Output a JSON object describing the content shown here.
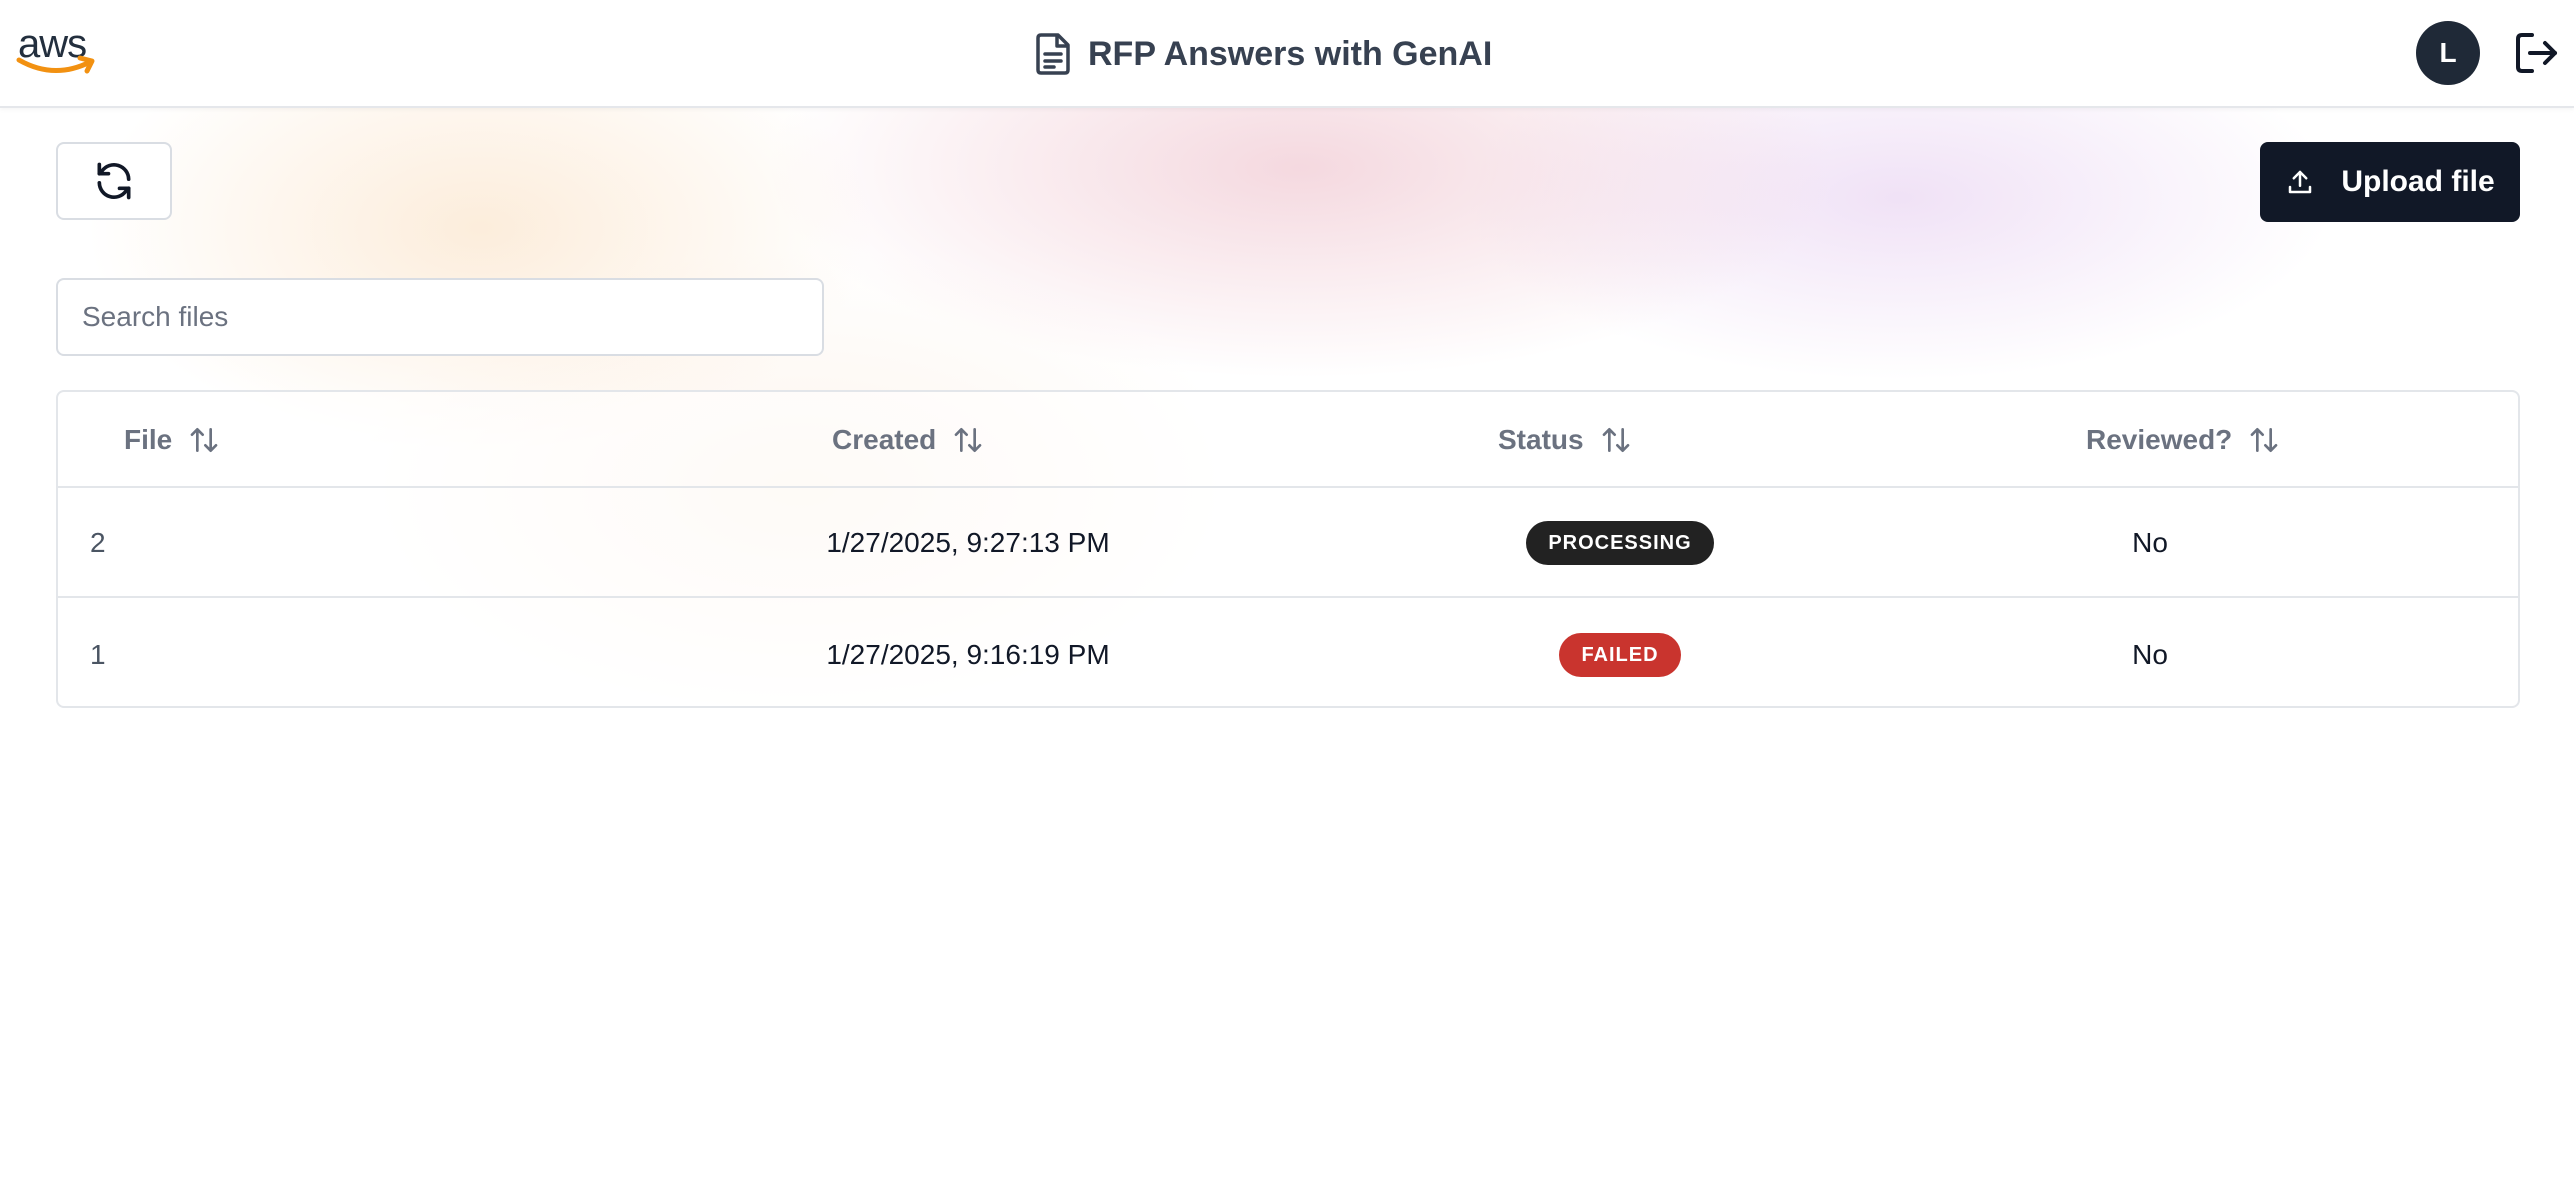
{
  "app": {
    "logo_text": "aws",
    "title": "RFP Answers with GenAI",
    "user_initial": "L"
  },
  "toolbar": {
    "refresh_icon": "refresh-icon",
    "upload_label": "Upload file",
    "upload_icon": "upload-icon"
  },
  "search": {
    "placeholder": "Search files",
    "value": ""
  },
  "table": {
    "columns": [
      {
        "label": "File",
        "sort_icon": "sort-icon"
      },
      {
        "label": "Created",
        "sort_icon": "sort-icon"
      },
      {
        "label": "Status",
        "sort_icon": "sort-icon"
      },
      {
        "label": "Reviewed?",
        "sort_icon": "sort-icon"
      }
    ],
    "rows": [
      {
        "file": "2",
        "created": "1/27/2025, 9:27:13 PM",
        "status": "PROCESSING",
        "reviewed": "No"
      },
      {
        "file": "1",
        "created": "1/27/2025, 9:16:19 PM",
        "status": "FAILED",
        "reviewed": "No"
      }
    ]
  },
  "colors": {
    "processing": "#222222",
    "failed": "#c9342e",
    "primary_button": "#111827",
    "avatar": "#1f2937",
    "aws_smile": "#f29111"
  }
}
